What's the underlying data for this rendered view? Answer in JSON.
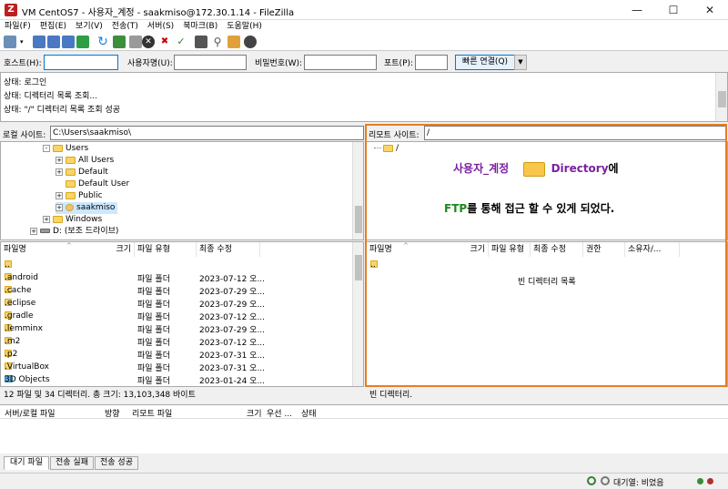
{
  "window": {
    "title": "VM CentOS7 - 사용자_계정 - saakmiso@172.30.1.14 - FileZilla"
  },
  "menu": [
    "파일(F)",
    "편집(E)",
    "보기(V)",
    "전송(T)",
    "서버(S)",
    "북마크(B)",
    "도움말(H)"
  ],
  "quickconnect": {
    "host_label": "호스트(H):",
    "user_label": "사용자명(U):",
    "pass_label": "비밀번호(W):",
    "port_label": "포트(P):",
    "connect_label": "빠른 연결(Q)",
    "host_value": "",
    "user_value": "",
    "pass_value": "",
    "port_value": ""
  },
  "log": [
    {
      "label": "상태:",
      "text": "로그인"
    },
    {
      "label": "상태:",
      "text": "디렉터리 목록 조회..."
    },
    {
      "label": "상태:",
      "text": "\"/\" 디렉터리 목록 조회 성공"
    }
  ],
  "local": {
    "path_label": "로컬 사이트:",
    "path": "C:\\Users\\saakmiso\\",
    "tree": [
      "Users",
      "All Users",
      "Default",
      "Default User",
      "Public",
      "saakmiso",
      "Windows",
      "D: (보조 드라이브)"
    ],
    "headers": {
      "name": "파일명",
      "size": "크기",
      "type": "파일 유형",
      "modified": "최종 수정"
    },
    "files": [
      {
        "name": "..",
        "type": "",
        "modified": ""
      },
      {
        "name": ".android",
        "type": "파일 폴더",
        "modified": "2023-07-12 오..."
      },
      {
        "name": ".cache",
        "type": "파일 폴더",
        "modified": "2023-07-29 오..."
      },
      {
        "name": ".eclipse",
        "type": "파일 폴더",
        "modified": "2023-07-29 오..."
      },
      {
        "name": ".gradle",
        "type": "파일 폴더",
        "modified": "2023-07-12 오..."
      },
      {
        "name": ".lemminx",
        "type": "파일 폴더",
        "modified": "2023-07-29 오..."
      },
      {
        "name": ".m2",
        "type": "파일 폴더",
        "modified": "2023-07-12 오..."
      },
      {
        "name": ".p2",
        "type": "파일 폴더",
        "modified": "2023-07-31 오..."
      },
      {
        "name": ".VirtualBox",
        "type": "파일 폴더",
        "modified": "2023-07-31 오..."
      },
      {
        "name": "3D Objects",
        "type": "파일 폴더",
        "modified": "2023-01-24 오..."
      }
    ],
    "status": "12 파일 및 34 디렉터리. 총 크기: 13,103,348 바이트"
  },
  "remote": {
    "path_label": "리모트 사이트:",
    "path": "/",
    "tree": [
      "/"
    ],
    "headers": {
      "name": "파일명",
      "size": "크기",
      "type": "파일 유형",
      "modified": "최종 수정",
      "perm": "권한",
      "owner": "소유자/..."
    },
    "files": [
      {
        "name": ".."
      }
    ],
    "empty": "빈 디렉터리 목록",
    "status": "빈 디렉터리."
  },
  "annotation": {
    "part1": "사용자_계정",
    "part2": "Directory",
    "part3": "에",
    "line2a": "FTP",
    "line2b": "를 통해 접근 할 수 있게 되었다."
  },
  "queue": {
    "headers": {
      "server": "서버/로컬 파일",
      "direction": "방향",
      "remote": "리모트 파일",
      "size": "크기",
      "priority": "우선 ...",
      "state": "상태"
    },
    "tabs": [
      "대기 파일",
      "전송 실패",
      "전송 성공"
    ]
  },
  "statusbar": {
    "queue": "대기열: 비었음"
  },
  "colors": {
    "highlight": "#e67e22",
    "annotation_purple": "#7b1fa2",
    "annotation_green": "#1b8a1b",
    "filezilla_red": "#bf1e1e"
  }
}
